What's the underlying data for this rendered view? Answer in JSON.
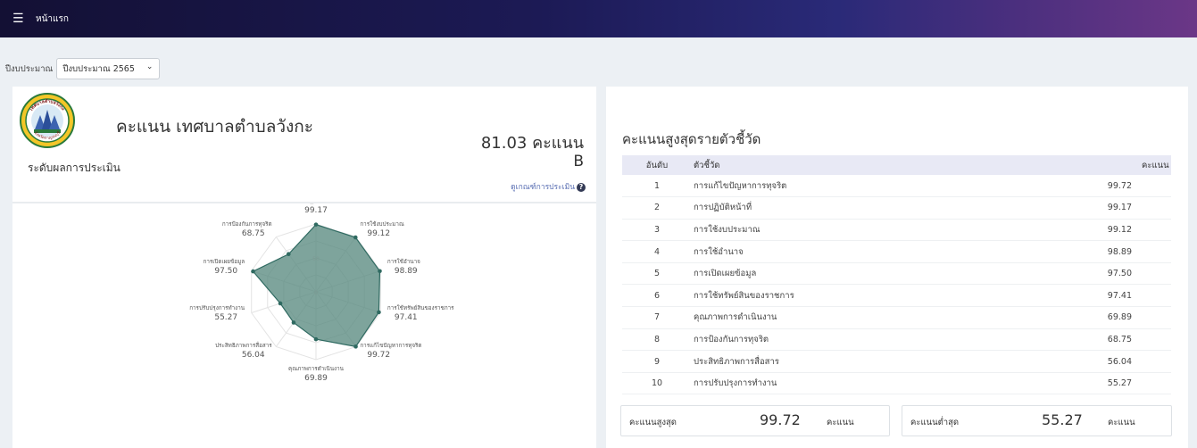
{
  "topbar": {
    "title": "หน้าแรก"
  },
  "filter": {
    "label": "ปีงบประมาณ",
    "selected": "ปีงบประมาณ 2565"
  },
  "summary": {
    "org_title": "คะแนน เทศบาลตำบลวังกะ",
    "score_total": "81.03 คะแนน",
    "level_label": "ระดับผลการประเมิน",
    "grade": "B",
    "criteria_link": "ดูเกณฑ์การประเมิน"
  },
  "chart_data": {
    "type": "radar",
    "axes": [
      "การปฏิบัติหน้าที่",
      "การใช้งบประมาณ",
      "การใช้อำนาจ",
      "การใช้ทรัพย์สินของราชการ",
      "การแก้ไขปัญหาการทุจริต",
      "คุณภาพการดำเนินงาน",
      "ประสิทธิภาพการสื่อสาร",
      "การปรับปรุงการทำงาน",
      "การเปิดเผยข้อมูล",
      "การป้องกันการทุจริต"
    ],
    "values": [
      99.17,
      99.12,
      98.89,
      97.41,
      99.72,
      69.89,
      56.04,
      55.27,
      97.5,
      68.75
    ],
    "value_labels": [
      "99.17",
      "99.12",
      "98.89",
      "97.41",
      "99.72",
      "69.89",
      "56.04",
      "55.27",
      "97.50",
      "68.75"
    ],
    "scale_labels": [
      "0",
      "50"
    ],
    "range": [
      0,
      100
    ],
    "fill_color": "#5a8a80",
    "line_color": "#2f6a61"
  },
  "ranking": {
    "title": "คะแนนสูงสุดรายตัวชี้วัด",
    "headers": {
      "rank": "อันดับ",
      "indicator": "ตัวชี้วัด",
      "score": "คะแนน"
    },
    "rows": [
      {
        "rank": "1",
        "indicator": "การแก้ไขปัญหาการทุจริต",
        "score": "99.72"
      },
      {
        "rank": "2",
        "indicator": "การปฏิบัติหน้าที่",
        "score": "99.17"
      },
      {
        "rank": "3",
        "indicator": "การใช้งบประมาณ",
        "score": "99.12"
      },
      {
        "rank": "4",
        "indicator": "การใช้อำนาจ",
        "score": "98.89"
      },
      {
        "rank": "5",
        "indicator": "การเปิดเผยข้อมูล",
        "score": "97.50"
      },
      {
        "rank": "6",
        "indicator": "การใช้ทรัพย์สินของราชการ",
        "score": "97.41"
      },
      {
        "rank": "7",
        "indicator": "คุณภาพการดำเนินงาน",
        "score": "69.89"
      },
      {
        "rank": "8",
        "indicator": "การป้องกันการทุจริต",
        "score": "68.75"
      },
      {
        "rank": "9",
        "indicator": "ประสิทธิภาพการสื่อสาร",
        "score": "56.04"
      },
      {
        "rank": "10",
        "indicator": "การปรับปรุงการทำงาน",
        "score": "55.27"
      }
    ],
    "max": {
      "label": "คะแนนสูงสุด",
      "value": "99.72",
      "unit": "คะแนน"
    },
    "min": {
      "label": "คะแนนต่ำสุด",
      "value": "55.27",
      "unit": "คะแนน"
    }
  },
  "logo": {
    "text_top": "เทศบาลตำบลวังกะ",
    "text_bottom": "จังหวัดกาญจนบุรี"
  },
  "icons": {
    "menu": "menu-icon",
    "chevron": "chevron-down-icon",
    "info": "info-circle-icon"
  }
}
